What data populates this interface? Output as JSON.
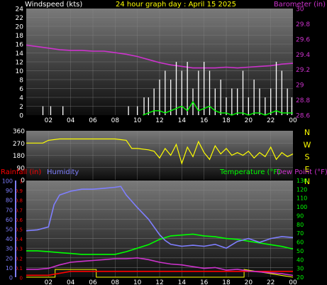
{
  "title": "24 hour graph day : April 15 2025",
  "colors": {
    "background": "#000000",
    "axis_text": "#ffffff",
    "wind_speed": "#ffffff",
    "wind_gust": "#00ff00",
    "barometer": "#cc33cc",
    "wind_dir": "#ffff00",
    "rainfall": "#ff0000",
    "humidity": "#7f7fff",
    "temperature": "#00ff00",
    "dew_point": "#cc33cc",
    "rain_rate": "#ffff00"
  },
  "chart_data": [
    {
      "type": "line",
      "name": "wind-barometer",
      "ylabel_left": "Windspeed (kts)",
      "ylabel_right": "Barometer (in)",
      "x_ticks": [
        "02",
        "04",
        "06",
        "08",
        "10",
        "12",
        "14",
        "16",
        "18",
        "20",
        "22",
        "00"
      ],
      "xlim": [
        0,
        24
      ],
      "ylim_left": [
        0,
        24
      ],
      "left_ticks": [
        "24",
        "22",
        "20",
        "18",
        "16",
        "14",
        "12",
        "10",
        "8",
        "6",
        "4",
        "2",
        "0"
      ],
      "ylim_right": [
        28.6,
        30.0
      ],
      "right_ticks": [
        "30",
        "29.8",
        "29.6",
        "29.4",
        "29.2",
        "29",
        "28.8",
        "28.6"
      ],
      "grid": true,
      "series": [
        {
          "key": "barometer",
          "x": [
            0,
            1,
            2,
            3,
            4,
            5,
            6,
            7,
            8,
            9,
            10,
            11,
            12,
            13,
            14,
            15,
            16,
            17,
            18,
            19,
            20,
            21,
            22,
            23,
            24
          ],
          "values": [
            29.52,
            29.5,
            29.48,
            29.46,
            29.45,
            29.45,
            29.44,
            29.44,
            29.42,
            29.4,
            29.37,
            29.33,
            29.29,
            29.26,
            29.24,
            29.22,
            29.22,
            29.22,
            29.23,
            29.22,
            29.23,
            29.24,
            29.25,
            29.27,
            29.28
          ]
        },
        {
          "key": "wind_speed",
          "x": [
            1.5,
            2.2,
            3.3,
            9.2,
            10.0,
            10.6,
            11.0,
            11.5,
            12.0,
            12.5,
            13.0,
            13.5,
            14.0,
            14.5,
            15.0,
            15.5,
            16.0,
            16.5,
            17.0,
            17.5,
            18.0,
            18.5,
            19.0,
            19.5,
            20.0,
            20.5,
            21.0,
            21.5,
            22.0,
            22.5,
            23.0,
            23.5,
            23.9
          ],
          "values": [
            2,
            2,
            2,
            2,
            2,
            4,
            4,
            6,
            8,
            10,
            8,
            12,
            10,
            12,
            6,
            10,
            12,
            10,
            6,
            8,
            4,
            6,
            6,
            10,
            4,
            8,
            6,
            4,
            6,
            12,
            10,
            6,
            4
          ]
        },
        {
          "key": "wind_gust",
          "x": [
            10.5,
            11.0,
            11.5,
            12.0,
            12.5,
            13.0,
            13.5,
            14.0,
            14.5,
            15.0,
            15.5,
            16.0,
            16.5,
            17.0,
            17.5,
            18.0,
            18.5,
            19.0,
            19.5,
            20.0,
            20.5,
            21.0,
            21.5,
            22.0,
            22.5,
            23.0,
            23.5,
            24.0
          ],
          "values": [
            0,
            0.5,
            1,
            1,
            0.5,
            1,
            1.5,
            2,
            1,
            3,
            1,
            1.5,
            2,
            1,
            0.5,
            0.5,
            0,
            0.5,
            0.5,
            0,
            0.5,
            0.5,
            0,
            0.5,
            1,
            0.5,
            0.5,
            0.5
          ]
        }
      ]
    },
    {
      "type": "line",
      "name": "wind-direction",
      "ylabel_right": "N W S E N",
      "xlim": [
        0,
        24
      ],
      "ylim": [
        0,
        360
      ],
      "left_ticks": [
        "360",
        "270",
        "180",
        "90",
        "0"
      ],
      "direction_letters": [
        "N",
        "W",
        "S",
        "E",
        "N"
      ],
      "series": [
        {
          "key": "wind_dir",
          "x": [
            0,
            1.5,
            2,
            3,
            4,
            5,
            6,
            7,
            8,
            9,
            9.5,
            10,
            11,
            11.5,
            12,
            12.5,
            13,
            13.5,
            14,
            14.5,
            15,
            15.5,
            16,
            16.5,
            17,
            17.5,
            18,
            18.5,
            19,
            19.5,
            20,
            20.5,
            21,
            21.5,
            22,
            22.5,
            23,
            23.5,
            24
          ],
          "values": [
            270,
            270,
            290,
            300,
            300,
            300,
            300,
            300,
            300,
            290,
            230,
            230,
            220,
            210,
            160,
            230,
            180,
            260,
            120,
            240,
            170,
            280,
            200,
            150,
            250,
            190,
            230,
            180,
            200,
            180,
            210,
            160,
            200,
            170,
            240,
            150,
            200,
            170,
            190
          ]
        }
      ]
    },
    {
      "type": "line",
      "name": "rain-humidity-temperature",
      "labels_left": [
        "Rainfall (in)",
        "Humidity"
      ],
      "labels_right": [
        "Temperature (°F)",
        "Dew Point (°F)"
      ],
      "x_ticks": [
        "02",
        "04",
        "06",
        "08",
        "10",
        "12",
        "14",
        "16",
        "18",
        "20",
        "22",
        "00"
      ],
      "xlim": [
        0,
        24
      ],
      "humidity_ticks": [
        "100",
        "90",
        "80",
        "70",
        "60",
        "50",
        "40",
        "30",
        "20",
        "10",
        "0"
      ],
      "ylim_humidity": [
        0,
        100
      ],
      "rain_ticks": [
        "1",
        "0.9",
        "0.8",
        "0.7",
        "0.6",
        "0.5",
        "0.4",
        "0.3",
        "0.2",
        "0.1",
        "0"
      ],
      "ylim_rain": [
        0,
        1
      ],
      "temp_ticks": [
        "130",
        "120",
        "110",
        "100",
        "90",
        "80",
        "70",
        "60",
        "50",
        "40",
        "30",
        "20"
      ],
      "ylim_temp": [
        20,
        130
      ],
      "series": [
        {
          "key": "humidity",
          "x": [
            0,
            1,
            2,
            2.5,
            3,
            4,
            5,
            6,
            7,
            8,
            8.5,
            9,
            10,
            11,
            12,
            12.5,
            13,
            14,
            15,
            16,
            17,
            18,
            19,
            20,
            21,
            22,
            23,
            24
          ],
          "values": [
            48,
            49,
            52,
            75,
            85,
            89,
            91,
            91,
            92,
            93,
            94,
            85,
            72,
            60,
            44,
            38,
            34,
            32,
            33,
            32,
            34,
            30,
            37,
            40,
            36,
            40,
            42,
            41
          ]
        },
        {
          "key": "temperature",
          "x": [
            0,
            1,
            2,
            3,
            4,
            5,
            6,
            7,
            8,
            9,
            10,
            11,
            12,
            13,
            14,
            15,
            16,
            17,
            18,
            19,
            20,
            21,
            22,
            23,
            24
          ],
          "values": [
            50,
            50,
            49,
            48,
            47,
            46,
            46,
            46,
            46,
            49,
            53,
            57,
            63,
            67,
            68,
            69,
            67,
            66,
            64,
            63,
            61,
            59,
            57,
            55,
            52
          ]
        },
        {
          "key": "dew_point",
          "x": [
            0,
            1,
            2,
            3,
            4,
            5,
            6,
            7,
            8,
            9,
            10,
            11,
            12,
            13,
            14,
            15,
            16,
            17,
            18,
            19,
            20,
            21,
            22,
            23,
            24
          ],
          "values": [
            29,
            29,
            30,
            34,
            37,
            38,
            39,
            40,
            41,
            41,
            42,
            40,
            37,
            35,
            34,
            32,
            30,
            31,
            28,
            29,
            27,
            26,
            25,
            24,
            22
          ]
        },
        {
          "key": "rainfall",
          "x": [
            0,
            1,
            2,
            3,
            4,
            5,
            6,
            7,
            8,
            9,
            10,
            11,
            12,
            13,
            14,
            15,
            16,
            17,
            18,
            19,
            20,
            21,
            22,
            23,
            24
          ],
          "values": [
            0.02,
            0.02,
            0.02,
            0.04,
            0.06,
            0.06,
            0.06,
            0.06,
            0.06,
            0.06,
            0.06,
            0.06,
            0.06,
            0.06,
            0.06,
            0.06,
            0.06,
            0.06,
            0.06,
            0.06,
            0.06,
            0.06,
            0.06,
            0.06,
            0.06
          ]
        },
        {
          "key": "rain_rate",
          "x": [
            0,
            2.6,
            2.6,
            6.3,
            6.3,
            19.6,
            19.6,
            24
          ],
          "values": [
            0,
            0,
            0.08,
            0.08,
            0,
            0,
            0.08,
            0
          ]
        }
      ]
    }
  ]
}
